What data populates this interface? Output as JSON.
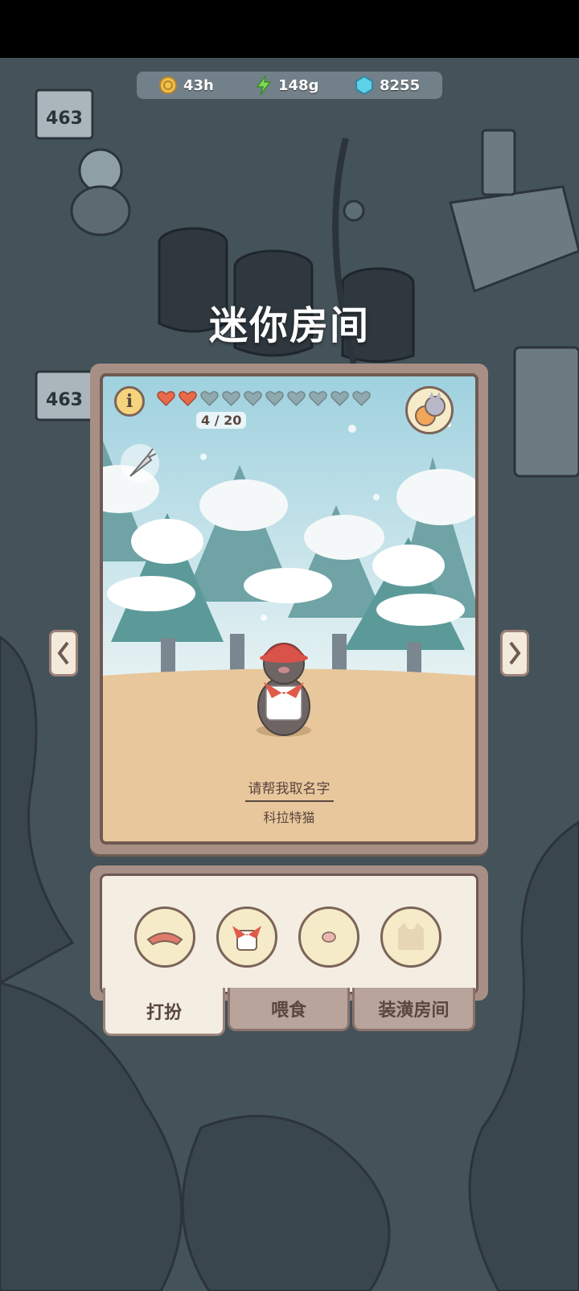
{
  "currency": {
    "coins": "43h",
    "energy": "148g",
    "gems": "8255"
  },
  "page_title": "迷你房间",
  "room": {
    "hearts_filled": 2,
    "hearts_total": 10,
    "heart_count": "4 / 20",
    "pet_name_prompt": "请帮我取名字",
    "pet_breed": "科拉特猫"
  },
  "tabs": [
    {
      "label": "打扮",
      "active": true
    },
    {
      "label": "喂食",
      "active": false
    },
    {
      "label": "装潢房间",
      "active": false
    }
  ],
  "items": [
    "hat-icon",
    "scarf-apron-icon",
    "nose-item-icon",
    "cat-silhouette-icon"
  ],
  "background_signs": [
    "463",
    "463"
  ],
  "colors": {
    "heart_filled": "#e86a4a",
    "heart_empty": "#8fa9ae",
    "frame": "#a88f86",
    "panel": "#f3ede2"
  }
}
